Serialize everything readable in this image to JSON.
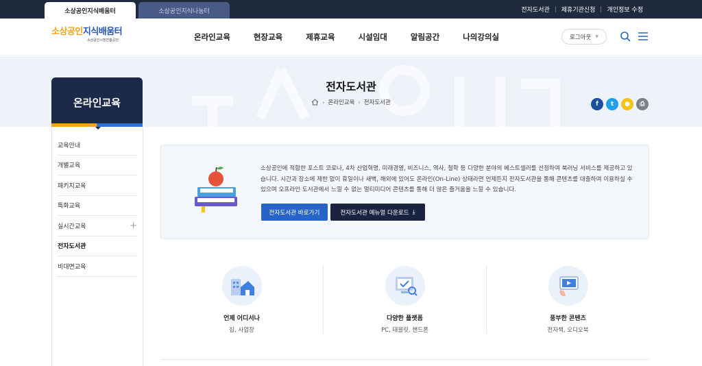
{
  "site_tabs": [
    {
      "label": "소상공인지식배움터"
    },
    {
      "label": "소상공인지식나눔터"
    }
  ],
  "util_links": [
    "전자도서관",
    "제휴기관신청",
    "개인정보 수정"
  ],
  "logo": {
    "main_a": "소상공인",
    "main_b": "지식배움터",
    "sub": "소상공인시장진흥공단"
  },
  "gnb": [
    "온라인교육",
    "현장교육",
    "제휴교육",
    "시설임대",
    "알림공간",
    "나의강의실"
  ],
  "header": {
    "logout_label": "로그아웃"
  },
  "page": {
    "title": "전자도서관",
    "breadcrumb": [
      "온라인교육",
      "전자도서관"
    ]
  },
  "share": [
    {
      "name": "facebook",
      "glyph": "f",
      "color": "#1d4fa1"
    },
    {
      "name": "twitter",
      "glyph": "t",
      "color": "#1ea1e8"
    },
    {
      "name": "kakaotalk",
      "glyph": "●",
      "color": "#f4c318"
    },
    {
      "name": "print",
      "glyph": "⎙",
      "color": "#7c8089"
    }
  ],
  "lnb": {
    "title": "온라인교육",
    "items": [
      {
        "label": "교육안내"
      },
      {
        "label": "개별교육"
      },
      {
        "label": "패키지교육"
      },
      {
        "label": "특화교육"
      },
      {
        "label": "실시간교육"
      },
      {
        "label": "전자도서관"
      },
      {
        "label": "비대면교육"
      }
    ]
  },
  "intro": {
    "text": "소상공인에 적합한 포스트 코로나, 4차 산업혁명, 미래경영, 비즈니스, 역사, 철학 등 다양한 분야의 베스트셀러를 선정하여 북러닝 서비스를 제공하고 있습니다. 시간과 장소에 제한 없이 휴일이나 새벽, 해외에 있어도 온라인(On-Line) 상태라면 언제든지 전자도서관을 통해 콘텐츠를 대출하여 이용하실 수 있으며 오프라인 도서관에서 느낄 수 없는 멀티미디어 콘텐츠를 통해 더 많은 즐거움을 느낄 수 있습니다.",
    "btn_go": "전자도서관 바로가기",
    "btn_manual": "전자도서관 메뉴얼 다운로드"
  },
  "features": [
    {
      "title": "언제 어디서나",
      "desc": "집, 사업장"
    },
    {
      "title": "다양한 플랫폼",
      "desc": "PC, 태블릿, 핸드폰"
    },
    {
      "title": "풍부한 콘텐츠",
      "desc": "전자책, 오디오북"
    }
  ],
  "colors": {
    "navy": "#1c2a4a",
    "primary": "#2764c8",
    "accent": "#f5a31a"
  }
}
